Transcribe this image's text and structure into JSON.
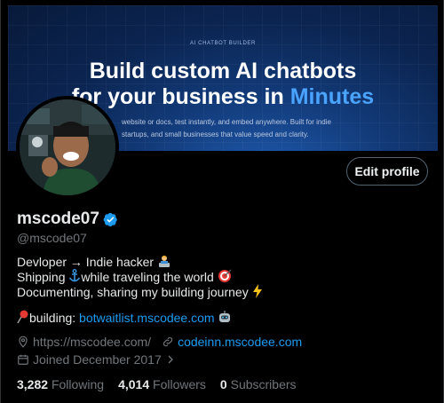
{
  "banner": {
    "kicker": "AI CHATBOT BUILDER",
    "headline_1": "Build custom AI chatbots",
    "headline_2_plain": "for your business in ",
    "headline_2_accent": "Minutes",
    "sub_1": "website or docs, test instantly, and embed anywhere. Built for indie",
    "sub_2": "startups, and small businesses that value speed and clarity."
  },
  "profile": {
    "name": "mscode07",
    "handle": "@mscode07",
    "edit_label": "Edit profile",
    "bio": [
      "Devloper → Indie hacker",
      "Shipping",
      "while traveling the world",
      "Documenting, sharing my building journey"
    ],
    "building_label": "building: ",
    "building_link": "botwaitlist.mscodee.com",
    "website": "https://mscodee.com/",
    "link2": "codeinn.mscodee.com",
    "joined": "Joined December 2017"
  },
  "stats": {
    "following_count": "3,282",
    "following_label": "Following",
    "followers_count": "4,014",
    "followers_label": "Followers",
    "subscribers_count": "0",
    "subscribers_label": "Subscribers"
  },
  "colors": {
    "accent": "#1d9bf0",
    "muted": "#71767b",
    "verified": "#1d9bf0"
  }
}
